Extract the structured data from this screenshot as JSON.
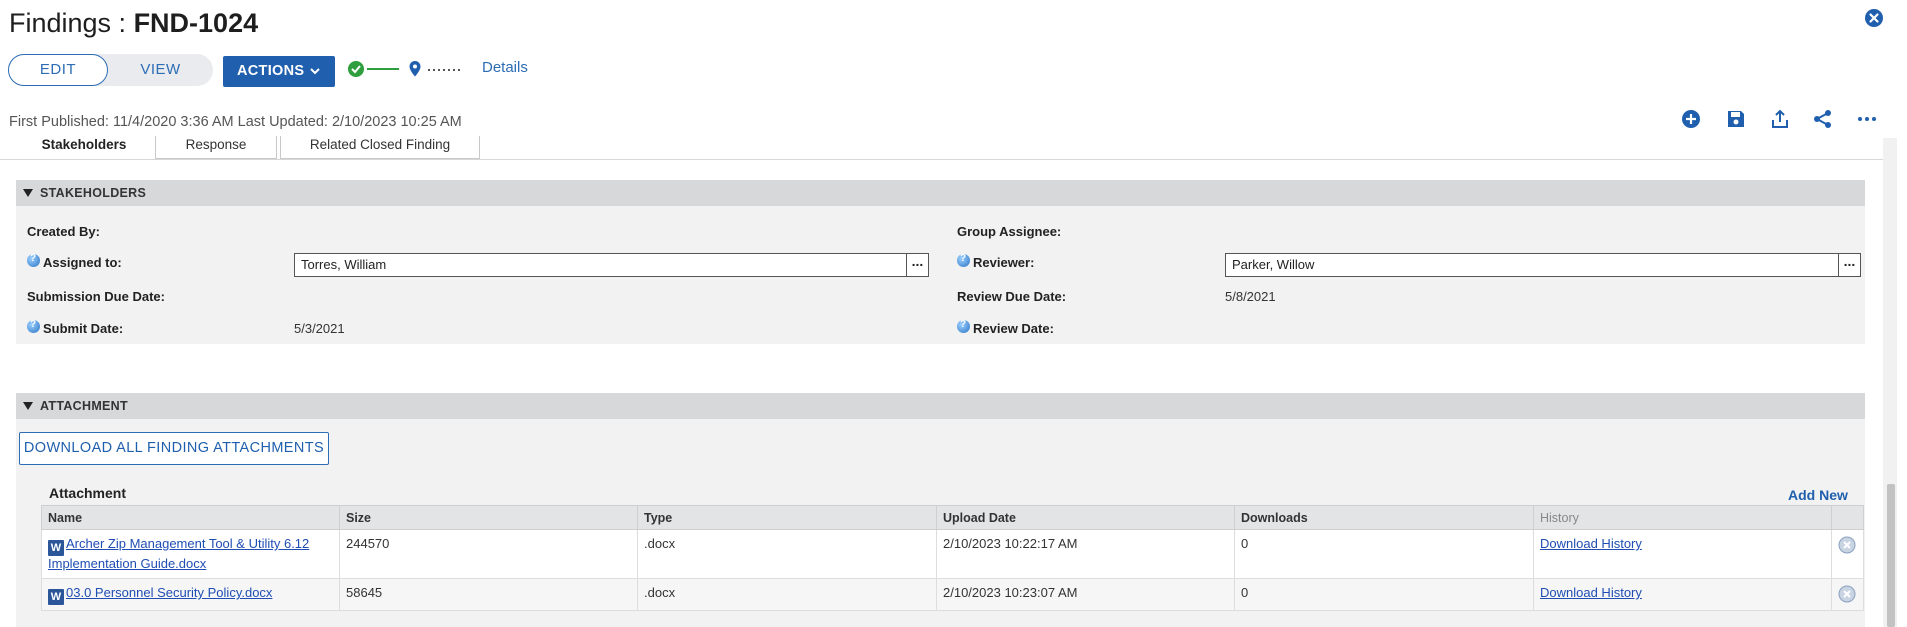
{
  "header": {
    "title_prefix": "Findings : ",
    "record_id": "FND-1024",
    "close_icon": "close-circle-icon",
    "edit_label": "EDIT",
    "view_label": "VIEW",
    "actions_label": "ACTIONS",
    "details_label": "Details",
    "published_text": "First Published: 11/4/2020 3:36 AM Last Updated: 2/10/2023 10:25 AM",
    "toolbar_icons": [
      "add-circle-icon",
      "save-icon",
      "export-icon",
      "share-icon",
      "more-icon"
    ]
  },
  "tabs": [
    {
      "label": "Stakeholders",
      "active": true
    },
    {
      "label": "Response",
      "active": false
    },
    {
      "label": "Related Closed Finding",
      "active": false
    }
  ],
  "stakeholders": {
    "header": "STAKEHOLDERS",
    "created_by_label": "Created By:",
    "assigned_to_label": "Assigned to:",
    "assigned_to_value": "Torres, William",
    "submission_due_label": "Submission Due Date:",
    "submit_date_label": "Submit Date:",
    "submit_date_value": "5/3/2021",
    "group_assignee_label": "Group Assignee:",
    "reviewer_label": "Reviewer:",
    "reviewer_value": "Parker, Willow",
    "review_due_label": "Review Due Date:",
    "review_due_value": "5/8/2021",
    "review_date_label": "Review Date:",
    "lookup_button": "..."
  },
  "attachment": {
    "header": "ATTACHMENT",
    "download_all_label": "DOWNLOAD ALL FINDING ATTACHMENTS",
    "table_title": "Attachment",
    "add_new_label": "Add New",
    "columns": [
      "Name",
      "Size",
      "Type",
      "Upload Date",
      "Downloads",
      "History"
    ],
    "rows": [
      {
        "name": "Archer Zip Management Tool & Utility 6.12 Implementation Guide.docx",
        "size": "244570",
        "type": ".docx",
        "upload_date": "2/10/2023 10:22:17 AM",
        "downloads": "0",
        "history": "Download History"
      },
      {
        "name": "03.0 Personnel Security Policy.docx",
        "size": "58645",
        "type": ".docx",
        "upload_date": "2/10/2023 10:23:07 AM",
        "downloads": "0",
        "history": "Download History"
      }
    ]
  },
  "colors": {
    "accent": "#1f5fad",
    "link": "#1f4db3",
    "success": "#2e9e3e",
    "section_bar": "#d7d8da"
  }
}
